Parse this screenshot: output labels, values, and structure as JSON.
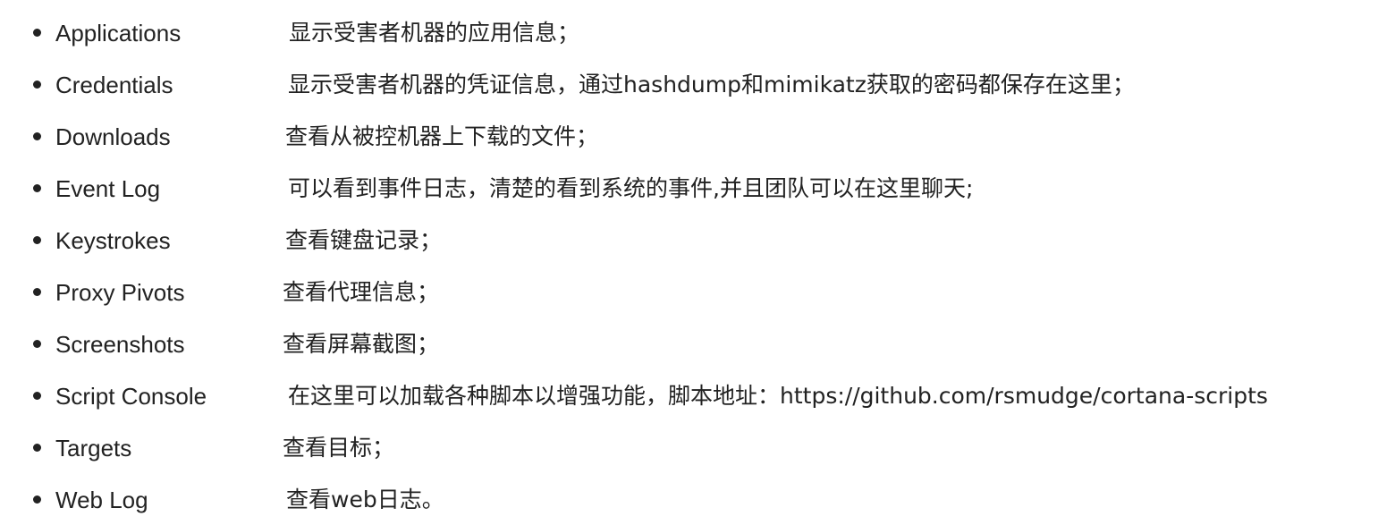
{
  "items": [
    {
      "term": "Applications",
      "desc": "显示受害者机器的应用信息；"
    },
    {
      "term": "Credentials",
      "desc": "显示受害者机器的凭证信息，通过hashdump和mimikatz获取的密码都保存在这里；"
    },
    {
      "term": "Downloads",
      "desc": "查看从被控机器上下载的文件；"
    },
    {
      "term": "Event Log",
      "desc": "可以看到事件日志，清楚的看到系统的事件,并且团队可以在这里聊天;"
    },
    {
      "term": "Keystrokes",
      "desc": "查看键盘记录；"
    },
    {
      "term": "Proxy Pivots",
      "desc": "查看代理信息；"
    },
    {
      "term": "Screenshots",
      "desc": "查看屏幕截图；"
    },
    {
      "term": "Script Console",
      "desc": "在这里可以加载各种脚本以增强功能，脚本地址：https://github.com/rsmudge/cortana-scripts"
    },
    {
      "term": "Targets",
      "desc": "查看目标；"
    },
    {
      "term": "Web Log",
      "desc": "查看web日志。"
    }
  ]
}
